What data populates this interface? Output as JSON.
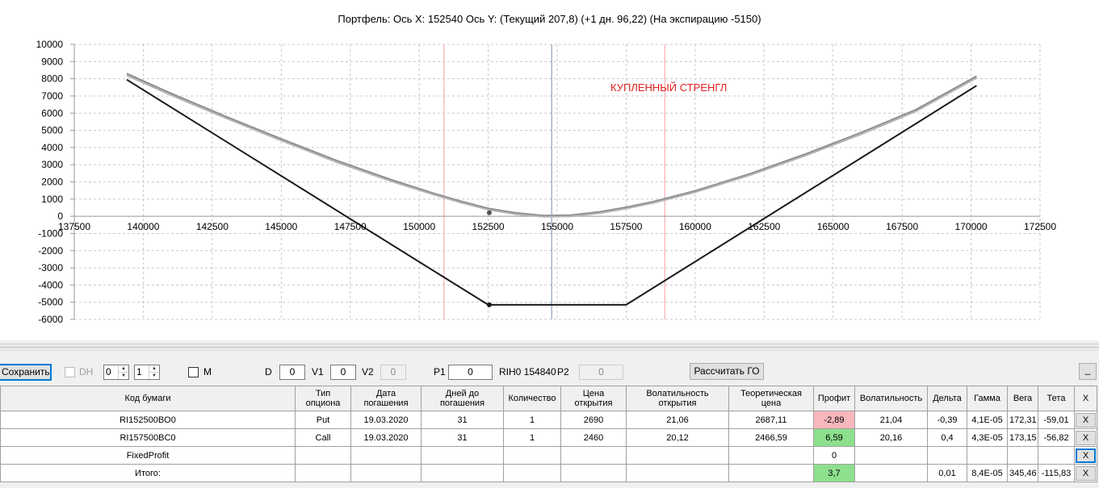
{
  "chart": {
    "title": "Портфель: Ось X: 152540 Ось Y:  (Текущий 207,8)  (+1 дн. 96,22)  (На экспирацию -5150)",
    "annotation": "КУПЛЕННЫЙ СТРЕНГЛ",
    "annotation_color": "#e02020"
  },
  "chart_data": {
    "type": "line",
    "title": "Портфель: Ось X: 152540 Ось Y:  (Текущий 207,8)  (+1 дн. 96,22)  (На экспирацию -5150)",
    "xlabel": "",
    "ylabel": "",
    "xlim": [
      137500,
      172500
    ],
    "ylim": [
      -6000,
      10000
    ],
    "x_ticks": [
      137500,
      140000,
      142500,
      145000,
      147500,
      150000,
      152500,
      155000,
      157500,
      160000,
      162500,
      165000,
      167500,
      170000,
      172500
    ],
    "y_ticks": [
      10000,
      9000,
      8000,
      7000,
      6000,
      5000,
      4000,
      3000,
      2000,
      1000,
      0,
      -1000,
      -2000,
      -3000,
      -4000,
      -5000,
      -6000
    ],
    "grid": true,
    "series": [
      {
        "color": "#8c8c8c",
        "points": [
          [
            139400,
            8300
          ],
          [
            141000,
            7150
          ],
          [
            143000,
            5800
          ],
          [
            145000,
            4500
          ],
          [
            147000,
            3250
          ],
          [
            149000,
            2120
          ],
          [
            150500,
            1350
          ],
          [
            151500,
            880
          ],
          [
            152500,
            460
          ],
          [
            153500,
            200
          ],
          [
            154500,
            40
          ],
          [
            155500,
            60
          ],
          [
            156500,
            250
          ],
          [
            157500,
            520
          ],
          [
            158500,
            860
          ],
          [
            160000,
            1480
          ],
          [
            162000,
            2480
          ],
          [
            164000,
            3620
          ],
          [
            166000,
            4860
          ],
          [
            168000,
            6200
          ],
          [
            170200,
            8150
          ]
        ]
      },
      {
        "color": "#b4b4b4",
        "points": [
          [
            139400,
            8200
          ],
          [
            141000,
            7050
          ],
          [
            143000,
            5700
          ],
          [
            145000,
            4400
          ],
          [
            147000,
            3150
          ],
          [
            149000,
            2030
          ],
          [
            150500,
            1270
          ],
          [
            151500,
            800
          ],
          [
            152500,
            380
          ],
          [
            153500,
            120
          ],
          [
            154500,
            -30
          ],
          [
            155500,
            -10
          ],
          [
            156500,
            170
          ],
          [
            157500,
            440
          ],
          [
            158500,
            780
          ],
          [
            160000,
            1400
          ],
          [
            162000,
            2400
          ],
          [
            164000,
            3530
          ],
          [
            166000,
            4760
          ],
          [
            168000,
            6100
          ],
          [
            170200,
            8050
          ]
        ]
      },
      {
        "color": "#1a1a1a",
        "points": [
          [
            139400,
            7950
          ],
          [
            152500,
            -5150
          ],
          [
            157500,
            -5150
          ],
          [
            170200,
            7600
          ]
        ]
      }
    ],
    "markers": [
      {
        "x": 152540,
        "y": 207.8,
        "color": "#555555"
      },
      {
        "x": 152540,
        "y": -5150,
        "color": "#1a1a1a"
      }
    ],
    "vertical_lines": [
      {
        "x": 150900,
        "color": "#f4a0a8"
      },
      {
        "x": 154800,
        "color": "#7a8cae"
      },
      {
        "x": 158900,
        "color": "#f4a0a8"
      }
    ]
  },
  "toolbar": {
    "save_label": "Сохранить",
    "dh_label": "DH",
    "spin1_value": "0",
    "spin2_value": "1",
    "m_label": "M",
    "d_label": "D",
    "d_value": "0",
    "v1_label": "V1",
    "v1_value": "0",
    "v2_label": "V2",
    "v2_value": "0",
    "p1_label": "P1",
    "p1_value": "0",
    "rih_label": "RIH0 154840",
    "p2_label": "P2",
    "p2_value": "0",
    "calc_label": "Рассчитать ГО",
    "minimize_label": "_"
  },
  "grid": {
    "headers": [
      "Код бумаги",
      "Тип опциона",
      "Дата погашения",
      "Дней до погашения",
      "Количество",
      "Цена открытия",
      "Волатильность открытия",
      "Теоретическая цена",
      "Профит",
      "Волатильность",
      "Дельта",
      "Гамма",
      "Вега",
      "Тета",
      "X"
    ],
    "rows": [
      {
        "code": "RI152500BO0",
        "type": "Put",
        "date": "19.03.2020",
        "days": "31",
        "qty": "1",
        "open_price": "2690",
        "open_vol": "21,06",
        "theo_price": "2687,11",
        "profit": "-2,89",
        "vol": "21,04",
        "delta": "-0,39",
        "gamma": "4,1E-05",
        "vega": "172,31",
        "theta": "-59,01",
        "x": "X"
      },
      {
        "code": "RI157500BC0",
        "type": "Call",
        "date": "19.03.2020",
        "days": "31",
        "qty": "1",
        "open_price": "2460",
        "open_vol": "20,12",
        "theo_price": "2466,59",
        "profit": "6,59",
        "vol": "20,16",
        "delta": "0,4",
        "gamma": "4,3E-05",
        "vega": "173,15",
        "theta": "-56,82",
        "x": "X"
      },
      {
        "code": "FixedProfit",
        "type": "",
        "date": "",
        "days": "",
        "qty": "",
        "open_price": "",
        "open_vol": "",
        "theo_price": "",
        "profit": "0",
        "vol": "",
        "delta": "",
        "gamma": "",
        "vega": "",
        "theta": "",
        "x": "X"
      },
      {
        "code": "Итого:",
        "type": "",
        "date": "",
        "days": "",
        "qty": "",
        "open_price": "",
        "open_vol": "",
        "theo_price": "",
        "profit": "3,7",
        "vol": "",
        "delta": "0,01",
        "gamma": "8,4E-05",
        "vega": "345,46",
        "theta": "-115,83",
        "x": "X"
      }
    ]
  }
}
